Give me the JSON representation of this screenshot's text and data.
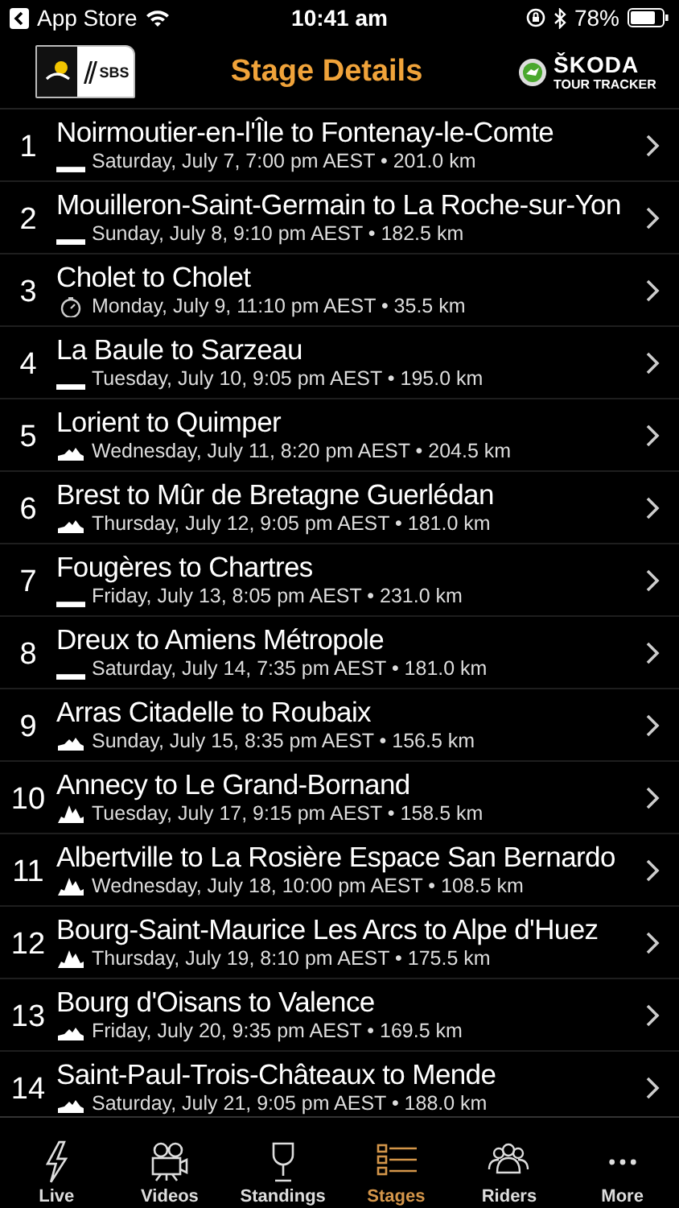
{
  "status_bar": {
    "back_app": "App Store",
    "time": "10:41 am",
    "battery": "78%"
  },
  "header": {
    "title": "Stage Details",
    "left_logo_text": "SBS",
    "right_logo_brand": "ŠKODA",
    "right_logo_sub": "TOUR TRACKER"
  },
  "stages": [
    {
      "number": "1",
      "route": "Noirmoutier-en-l'Île to Fontenay-le-Comte",
      "details": "Saturday, July 7, 7:00 pm AEST • 201.0 km",
      "kind": "flat"
    },
    {
      "number": "2",
      "route": "Mouilleron-Saint-Germain to La Roche-sur-Yon",
      "details": "Sunday, July 8, 9:10 pm AEST • 182.5 km",
      "kind": "flat"
    },
    {
      "number": "3",
      "route": "Cholet to Cholet",
      "details": "Monday, July 9, 11:10 pm AEST • 35.5 km",
      "kind": "timetrial"
    },
    {
      "number": "4",
      "route": "La Baule to Sarzeau",
      "details": "Tuesday, July 10, 9:05 pm AEST • 195.0 km",
      "kind": "flat"
    },
    {
      "number": "5",
      "route": "Lorient to Quimper",
      "details": "Wednesday, July 11, 8:20 pm AEST • 204.5 km",
      "kind": "hilly"
    },
    {
      "number": "6",
      "route": "Brest to Mûr de Bretagne Guerlédan",
      "details": "Thursday, July 12, 9:05 pm AEST • 181.0 km",
      "kind": "hilly"
    },
    {
      "number": "7",
      "route": "Fougères to Chartres",
      "details": "Friday, July 13, 8:05 pm AEST • 231.0 km",
      "kind": "flat"
    },
    {
      "number": "8",
      "route": "Dreux to Amiens Métropole",
      "details": "Saturday, July 14, 7:35 pm AEST • 181.0 km",
      "kind": "flat"
    },
    {
      "number": "9",
      "route": "Arras Citadelle to Roubaix",
      "details": "Sunday, July 15, 8:35 pm AEST • 156.5 km",
      "kind": "hilly"
    },
    {
      "number": "10",
      "route": "Annecy to Le Grand-Bornand",
      "details": "Tuesday, July 17, 9:15 pm AEST • 158.5 km",
      "kind": "mountain"
    },
    {
      "number": "11",
      "route": "Albertville to La Rosière Espace San Bernardo",
      "details": "Wednesday, July 18, 10:00 pm AEST • 108.5 km",
      "kind": "mountain"
    },
    {
      "number": "12",
      "route": "Bourg-Saint-Maurice Les Arcs to Alpe d'Huez",
      "details": "Thursday, July 19, 8:10 pm AEST • 175.5 km",
      "kind": "mountain"
    },
    {
      "number": "13",
      "route": "Bourg d'Oisans to Valence",
      "details": "Friday, July 20, 9:35 pm AEST • 169.5 km",
      "kind": "hilly"
    },
    {
      "number": "14",
      "route": "Saint-Paul-Trois-Châteaux to Mende",
      "details": "Saturday, July 21, 9:05 pm AEST • 188.0 km",
      "kind": "hilly"
    }
  ],
  "tab_bar": [
    {
      "label": "Live",
      "kind": "live",
      "selected": false
    },
    {
      "label": "Videos",
      "kind": "videos",
      "selected": false
    },
    {
      "label": "Standings",
      "kind": "standings",
      "selected": false
    },
    {
      "label": "Stages",
      "kind": "stages",
      "selected": true
    },
    {
      "label": "Riders",
      "kind": "riders",
      "selected": false
    },
    {
      "label": "More",
      "kind": "more",
      "selected": false
    }
  ]
}
